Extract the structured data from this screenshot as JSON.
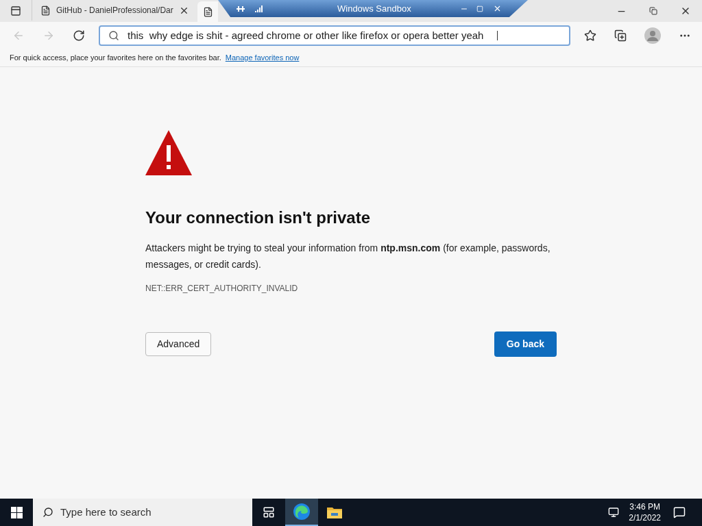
{
  "tabs": [
    {
      "title": "GitHub - DanielProfessional/Dar",
      "selected": false
    },
    {
      "selected": true
    }
  ],
  "sandbox_bar": {
    "title": "Windows Sandbox"
  },
  "address_bar": {
    "value": "this  why edge is shit - agreed chrome or other like firefox or opera better yeah"
  },
  "favorites_bar": {
    "message": "For quick access, place your favorites here on the favorites bar.",
    "link": "Manage favorites now"
  },
  "error": {
    "heading": "Your connection isn't private",
    "message": "Attackers might be trying to steal your information from **ntp.msn.com** (for example, passwords, messages, or credit cards).",
    "code": "NET::ERR_CERT_AUTHORITY_INVALID",
    "buttons": [
      {
        "label": "Advanced",
        "kind": "secondary"
      },
      {
        "label": "Go back",
        "kind": "primary"
      }
    ]
  },
  "taskbar": {
    "search_placeholder": "Type here to search",
    "apps": [
      {
        "kind": "edge",
        "selected": true
      },
      {
        "kind": "explorer",
        "selected": false
      }
    ],
    "time": "3:46 PM",
    "date": "2/1/2022"
  }
}
